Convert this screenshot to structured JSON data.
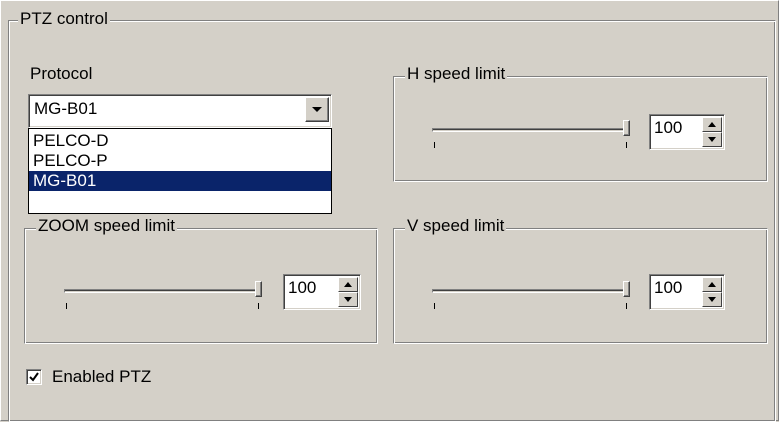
{
  "group": {
    "title": "PTZ control"
  },
  "protocol": {
    "label": "Protocol",
    "selected": "MG-B01",
    "options": [
      "PELCO-D",
      "PELCO-P",
      "MG-B01"
    ],
    "selected_index": 2
  },
  "h_speed": {
    "title": "H speed limit",
    "value": "100",
    "slider_level": 1.0
  },
  "zoom_speed": {
    "title": "ZOOM speed limit",
    "value": "100",
    "slider_level": 1.0
  },
  "v_speed": {
    "title": "V speed limit",
    "value": "100",
    "slider_level": 1.0
  },
  "enable_ptz": {
    "label": "Enabled PTZ",
    "checked": true
  },
  "icons": {
    "combo_button": "chevron-down-icon",
    "spin_up": "triangle-up-icon",
    "spin_down": "triangle-down-icon",
    "checkbox_mark": "check-icon"
  },
  "colors": {
    "background": "#d4d0c8",
    "selection": "#0a246a",
    "selection_text": "#ffffff"
  }
}
